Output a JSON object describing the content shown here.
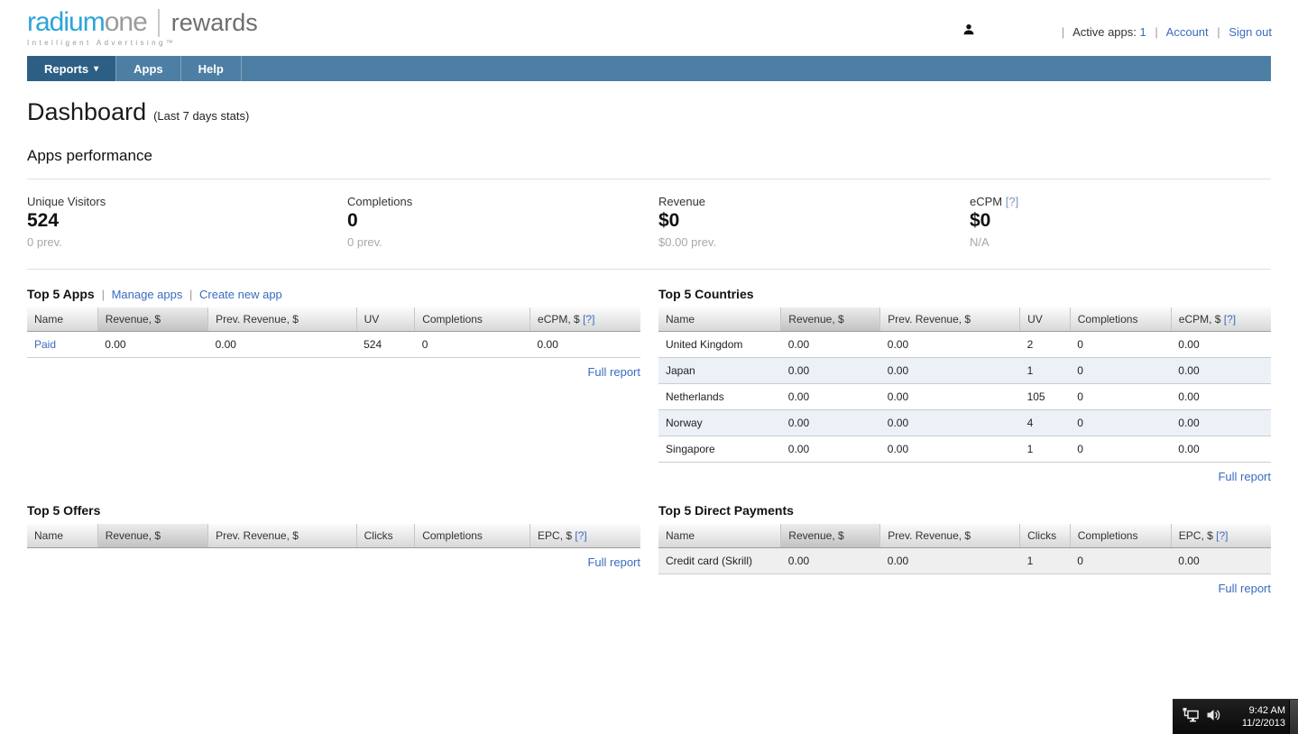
{
  "ui": {
    "separator": "|"
  },
  "colors": {
    "nav_bar": "#4d7fa4",
    "nav_active": "#2d5f84",
    "link_blue": "#3a6bc0",
    "logo_blue": "#2ca5d8",
    "shaded_row_blue": "#ecf1f8",
    "shaded_row_gray": "#efefef"
  },
  "header": {
    "logo": {
      "radium": "radium",
      "one": "one",
      "product": "rewards",
      "tagline": "Intelligent Advertising™"
    },
    "user": {
      "active_apps_label": "Active apps:",
      "active_apps_count": "1",
      "account": "Account",
      "sign_out": "Sign out"
    }
  },
  "nav": {
    "reports": "Reports",
    "reports_caret": "▾",
    "apps": "Apps",
    "help": "Help"
  },
  "page": {
    "title": "Dashboard",
    "subtitle": "(Last 7 days stats)",
    "section_heading": "Apps performance"
  },
  "stats": [
    {
      "label": "Unique Visitors",
      "value": "524",
      "prev": "0 prev."
    },
    {
      "label": "Completions",
      "value": "0",
      "prev": "0 prev."
    },
    {
      "label": "Revenue",
      "value": "$0",
      "prev": "$0.00 prev."
    },
    {
      "label": "eCPM",
      "help": "[?]",
      "value": "$0",
      "prev": "N/A"
    }
  ],
  "tables": {
    "apps": {
      "title": "Top 5 Apps",
      "links": {
        "manage": "Manage apps",
        "create": "Create new app"
      },
      "columns": [
        {
          "label": "Name"
        },
        {
          "label": "Revenue, $"
        },
        {
          "label": "Prev. Revenue, $"
        },
        {
          "label": "UV"
        },
        {
          "label": "Completions"
        },
        {
          "label": "eCPM, $",
          "help": "[?]"
        }
      ],
      "rows": [
        [
          "Paid",
          "0.00",
          "0.00",
          "524",
          "0",
          "0.00"
        ]
      ],
      "full_report": "Full report"
    },
    "countries": {
      "title": "Top 5 Countries",
      "columns": [
        {
          "label": "Name"
        },
        {
          "label": "Revenue, $"
        },
        {
          "label": "Prev. Revenue, $"
        },
        {
          "label": "UV"
        },
        {
          "label": "Completions"
        },
        {
          "label": "eCPM, $",
          "help": "[?]"
        }
      ],
      "rows": [
        [
          "United Kingdom",
          "0.00",
          "0.00",
          "2",
          "0",
          "0.00"
        ],
        [
          "Japan",
          "0.00",
          "0.00",
          "1",
          "0",
          "0.00"
        ],
        [
          "Netherlands",
          "0.00",
          "0.00",
          "105",
          "0",
          "0.00"
        ],
        [
          "Norway",
          "0.00",
          "0.00",
          "4",
          "0",
          "0.00"
        ],
        [
          "Singapore",
          "0.00",
          "0.00",
          "1",
          "0",
          "0.00"
        ]
      ],
      "full_report": "Full report"
    },
    "offers": {
      "title": "Top 5 Offers",
      "columns": [
        {
          "label": "Name"
        },
        {
          "label": "Revenue, $"
        },
        {
          "label": "Prev. Revenue, $"
        },
        {
          "label": "Clicks"
        },
        {
          "label": "Completions"
        },
        {
          "label": "EPC, $",
          "help": "[?]"
        }
      ],
      "rows": [],
      "full_report": "Full report"
    },
    "payments": {
      "title": "Top 5 Direct Payments",
      "columns": [
        {
          "label": "Name"
        },
        {
          "label": "Revenue, $"
        },
        {
          "label": "Prev. Revenue, $"
        },
        {
          "label": "Clicks"
        },
        {
          "label": "Completions"
        },
        {
          "label": "EPC, $",
          "help": "[?]"
        }
      ],
      "rows": [
        [
          "Credit card (Skrill)",
          "0.00",
          "0.00",
          "1",
          "0",
          "0.00"
        ]
      ],
      "full_report": "Full report"
    }
  },
  "tray": {
    "time": "9:42 AM",
    "date": "11/2/2013"
  }
}
